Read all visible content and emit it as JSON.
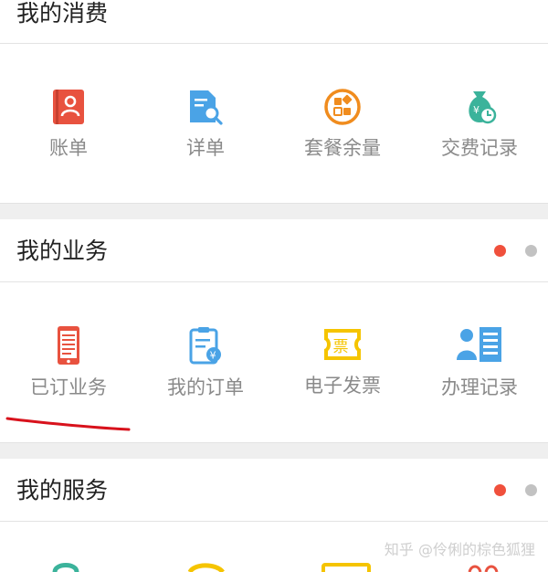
{
  "consumption": {
    "title": "我的消费",
    "items": [
      {
        "label": "账单",
        "icon": "bill-icon"
      },
      {
        "label": "详单",
        "icon": "detail-search-icon"
      },
      {
        "label": "套餐余量",
        "icon": "package-balance-icon"
      },
      {
        "label": "交费记录",
        "icon": "payment-record-icon"
      }
    ]
  },
  "business": {
    "title": "我的业务",
    "items": [
      {
        "label": "已订业务",
        "icon": "subscribed-phone-icon"
      },
      {
        "label": "我的订单",
        "icon": "order-icon"
      },
      {
        "label": "电子发票",
        "icon": "e-invoice-icon"
      },
      {
        "label": "办理记录",
        "icon": "handling-record-icon"
      }
    ]
  },
  "services": {
    "title": "我的服务"
  },
  "watermark": "知乎 @伶俐的棕色狐狸",
  "colors": {
    "red": "#e8523f",
    "blue": "#4aa3e6",
    "orange": "#f08c1e",
    "green": "#3bb39b",
    "yellow": "#f5c400",
    "dot_active": "#f0503c",
    "dot_inactive": "#c2c2c2",
    "annotation": "#d8121c"
  }
}
